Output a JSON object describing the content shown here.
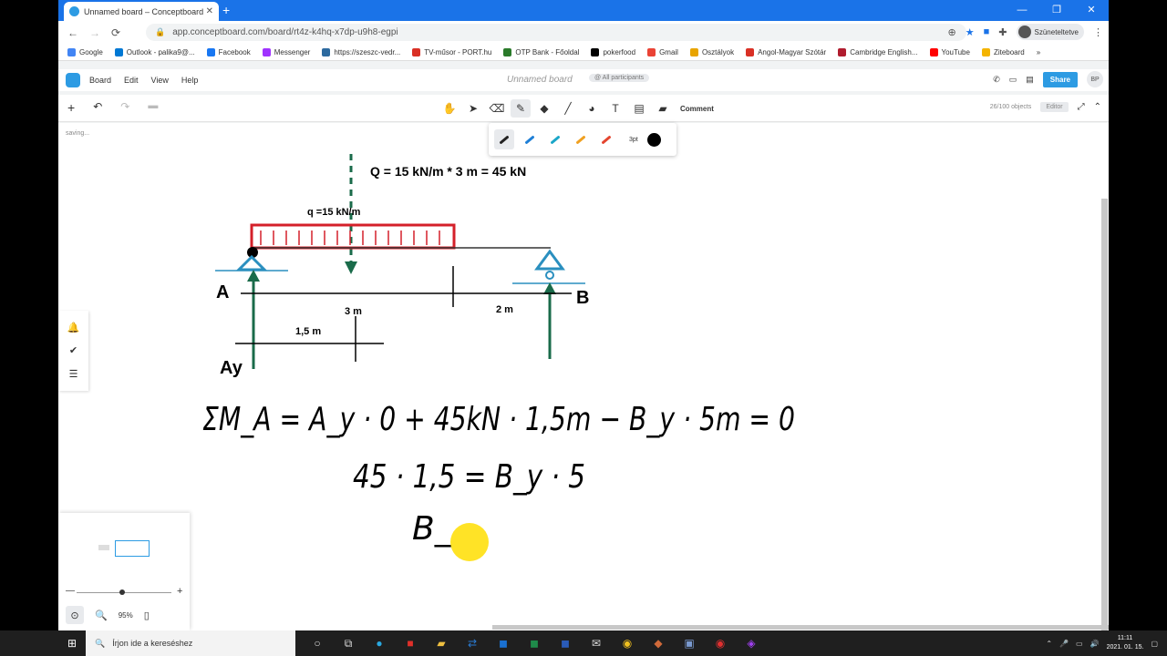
{
  "browser": {
    "tab_title": "Unnamed board – Conceptboard",
    "url": "app.conceptboard.com/board/rt4z-k4hq-x7dp-u9h8-egpi",
    "profile_label": "Szüneteltetve",
    "bookmarks": [
      "Google",
      "Outlook - palika9@...",
      "Facebook",
      "Messenger",
      "https://szeszc-vedr...",
      "TV-műsor - PORT.hu",
      "OTP Bank - Főoldal",
      "pokerfood",
      "Gmail",
      "Osztályok",
      "Angol-Magyar Szótár",
      "Cambridge English...",
      "YouTube",
      "Ziteboard"
    ],
    "bookmark_colors": [
      "#4285f4",
      "#0078d4",
      "#1877f2",
      "#a033ff",
      "#2d6a9f",
      "#d93025",
      "#2a7a2a",
      "#000000",
      "#ea4335",
      "#e8a400",
      "#d93025",
      "#b01c2e",
      "#ff0000",
      "#f4b400"
    ]
  },
  "app": {
    "menu": [
      "Board",
      "Edit",
      "View",
      "Help"
    ],
    "board_title": "Unnamed board",
    "participants": "@ All participants",
    "share_label": "Share",
    "user_initials": "BP",
    "comment_label": "Comment",
    "objects_count": "26/100 objects",
    "role_label": "Editor",
    "saving_label": "saving...",
    "pen_size": "3pt",
    "pen_colors": [
      "#222222",
      "#1e7fd6",
      "#1aa6c8",
      "#f0a020",
      "#e4452f"
    ],
    "zoom": "95%"
  },
  "drawing": {
    "total_load": "Q = 15 kN/m * 3 m = 45 kN",
    "distributed_load": "q =15 kN/m",
    "label_a": "A",
    "label_b": "B",
    "label_ay": "Ay",
    "dim_3m": "3 m",
    "dim_2m": "2 m",
    "dim_15m": "1,5 m",
    "eq1": "ΣM_A = A_y · 0 + 45kN · 1,5m − B_y · 5m = 0",
    "eq2": "45 · 1,5 = B_y · 5",
    "eq3": "B_"
  },
  "taskbar": {
    "search_placeholder": "Írjon ide a kereséshez",
    "time": "11:11",
    "date": "2021. 01. 15."
  }
}
